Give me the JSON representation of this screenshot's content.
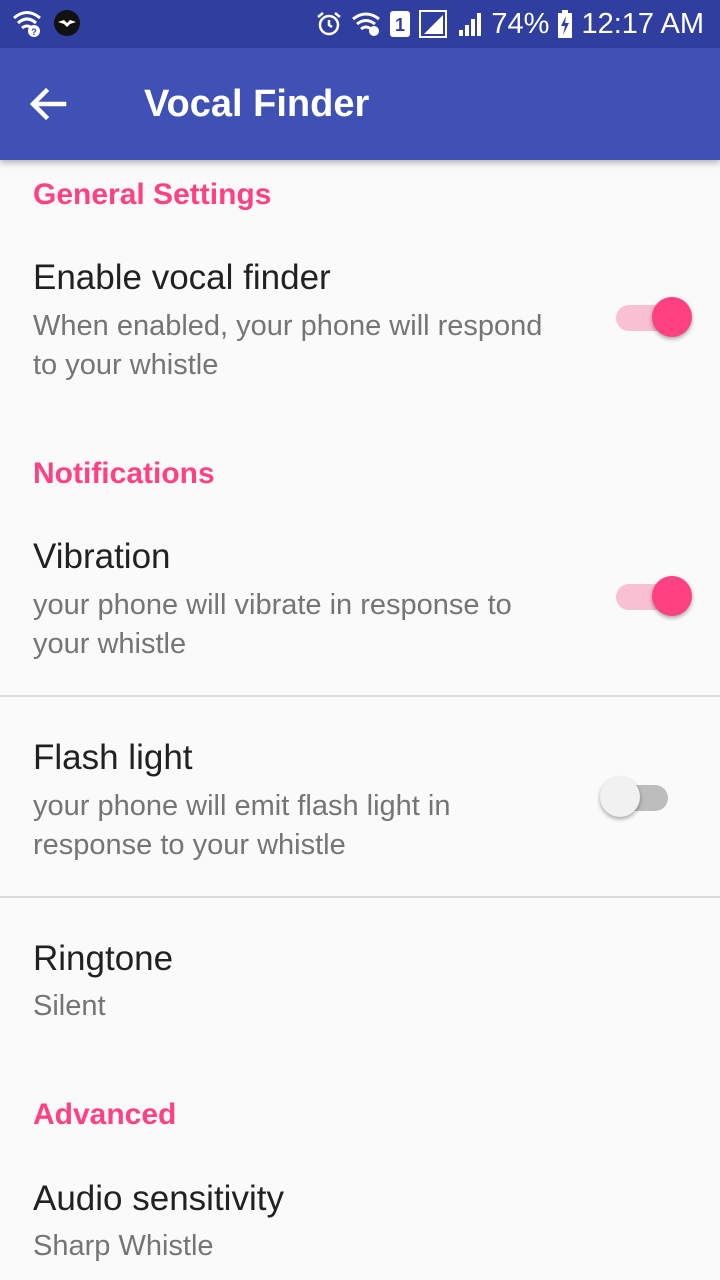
{
  "status_bar": {
    "battery_percent": "74%",
    "time": "12:17 AM",
    "sim_slot": "1",
    "icons": [
      "wifi-icon",
      "app-notification-icon",
      "alarm-icon",
      "wifi-calling-icon",
      "sim-icon",
      "signal-icon",
      "signal-icon",
      "battery-charging-icon"
    ]
  },
  "toolbar": {
    "title": "Vocal Finder",
    "back_icon": "arrow-back-icon"
  },
  "colors": {
    "primary": "#3f51b5",
    "primary_dark": "#303f9f",
    "accent": "#ff4081"
  },
  "sections": {
    "general": "General Settings",
    "notifications": "Notifications",
    "advanced": "Advanced"
  },
  "prefs": {
    "enable_vocal_finder": {
      "title": "Enable vocal finder",
      "summary": "When enabled, your phone will respond to your whistle",
      "checked": true
    },
    "vibration": {
      "title": "Vibration",
      "summary": "your phone will vibrate in response to your whistle",
      "checked": true
    },
    "flash_light": {
      "title": "Flash light",
      "summary": "your phone will emit flash light in response to your whistle",
      "checked": false
    },
    "ringtone": {
      "title": "Ringtone",
      "summary": "Silent"
    },
    "audio_sensitivity": {
      "title": "Audio sensitivity",
      "summary": "Sharp Whistle"
    }
  }
}
